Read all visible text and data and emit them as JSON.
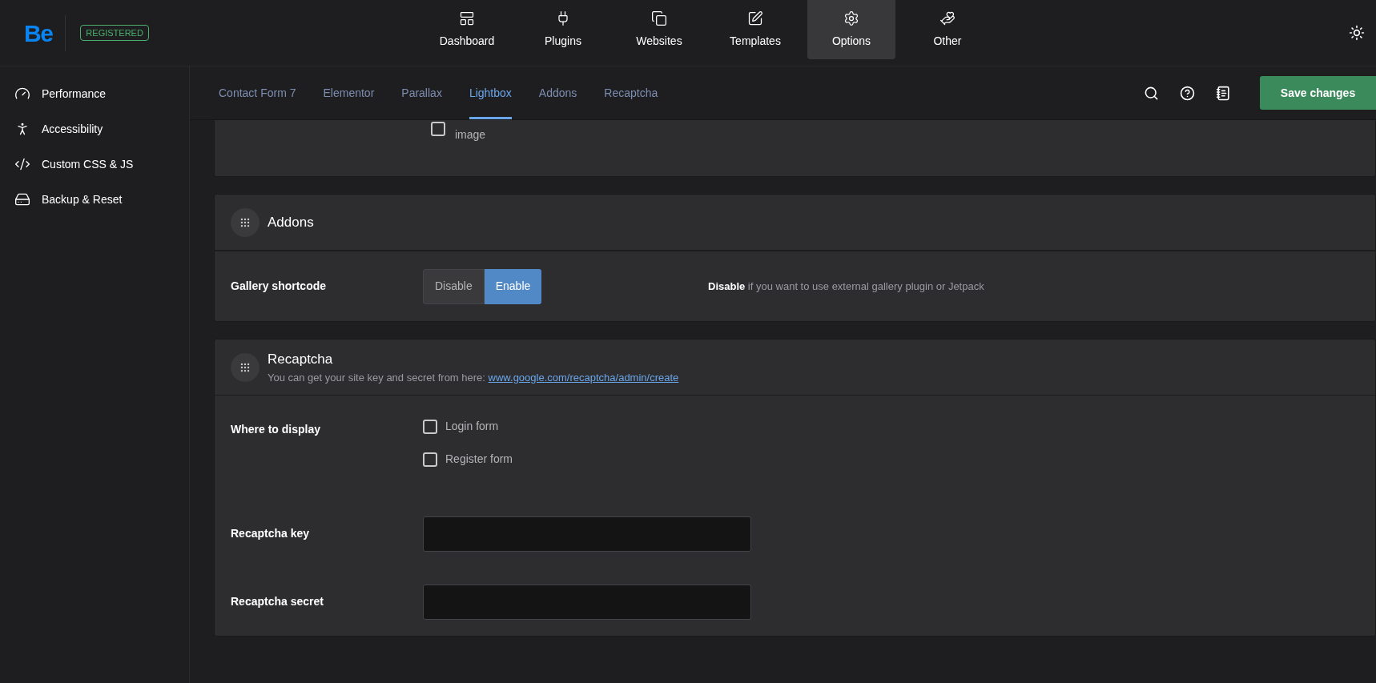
{
  "header": {
    "logo": "Be",
    "badge": "REGISTERED",
    "nav": [
      {
        "label": "Dashboard",
        "selected": false
      },
      {
        "label": "Plugins",
        "selected": false
      },
      {
        "label": "Websites",
        "selected": false
      },
      {
        "label": "Templates",
        "selected": false
      },
      {
        "label": "Options",
        "selected": true
      },
      {
        "label": "Other",
        "selected": false
      }
    ]
  },
  "sidebar": {
    "items": [
      {
        "label": "Performance"
      },
      {
        "label": "Accessibility"
      },
      {
        "label": "Custom CSS & JS"
      },
      {
        "label": "Backup & Reset"
      }
    ]
  },
  "subnav": {
    "tabs": [
      {
        "label": "Contact Form 7",
        "selected": false
      },
      {
        "label": "Elementor",
        "selected": false
      },
      {
        "label": "Parallax",
        "selected": false
      },
      {
        "label": "Lightbox",
        "selected": true
      },
      {
        "label": "Addons",
        "selected": false
      },
      {
        "label": "Recaptcha",
        "selected": false
      }
    ],
    "save_button": "Save changes"
  },
  "partial_section": {
    "checkbox": {
      "label": "image",
      "checked": false
    }
  },
  "sections": [
    {
      "title": "Addons",
      "rows": [
        {
          "kind": "segmented",
          "label": "Gallery shortcode",
          "options": [
            {
              "label": "Disable",
              "selected": false
            },
            {
              "label": "Enable",
              "selected": true
            }
          ],
          "description": "**Disable** if you want to use external gallery plugin or Jetpack"
        }
      ]
    },
    {
      "title": "Recaptcha",
      "subtitle": "You can get your site key and secret from here:",
      "link": "www.google.com/recaptcha/admin/create",
      "rows": [
        {
          "kind": "checkboxes",
          "label": "Where to display",
          "items": [
            {
              "label": "Login form",
              "checked": false
            },
            {
              "label": "Register form",
              "checked": false
            }
          ]
        },
        {
          "kind": "input",
          "label": "Recaptcha key"
        },
        {
          "kind": "input",
          "label": "Recaptcha secret"
        }
      ]
    }
  ]
}
